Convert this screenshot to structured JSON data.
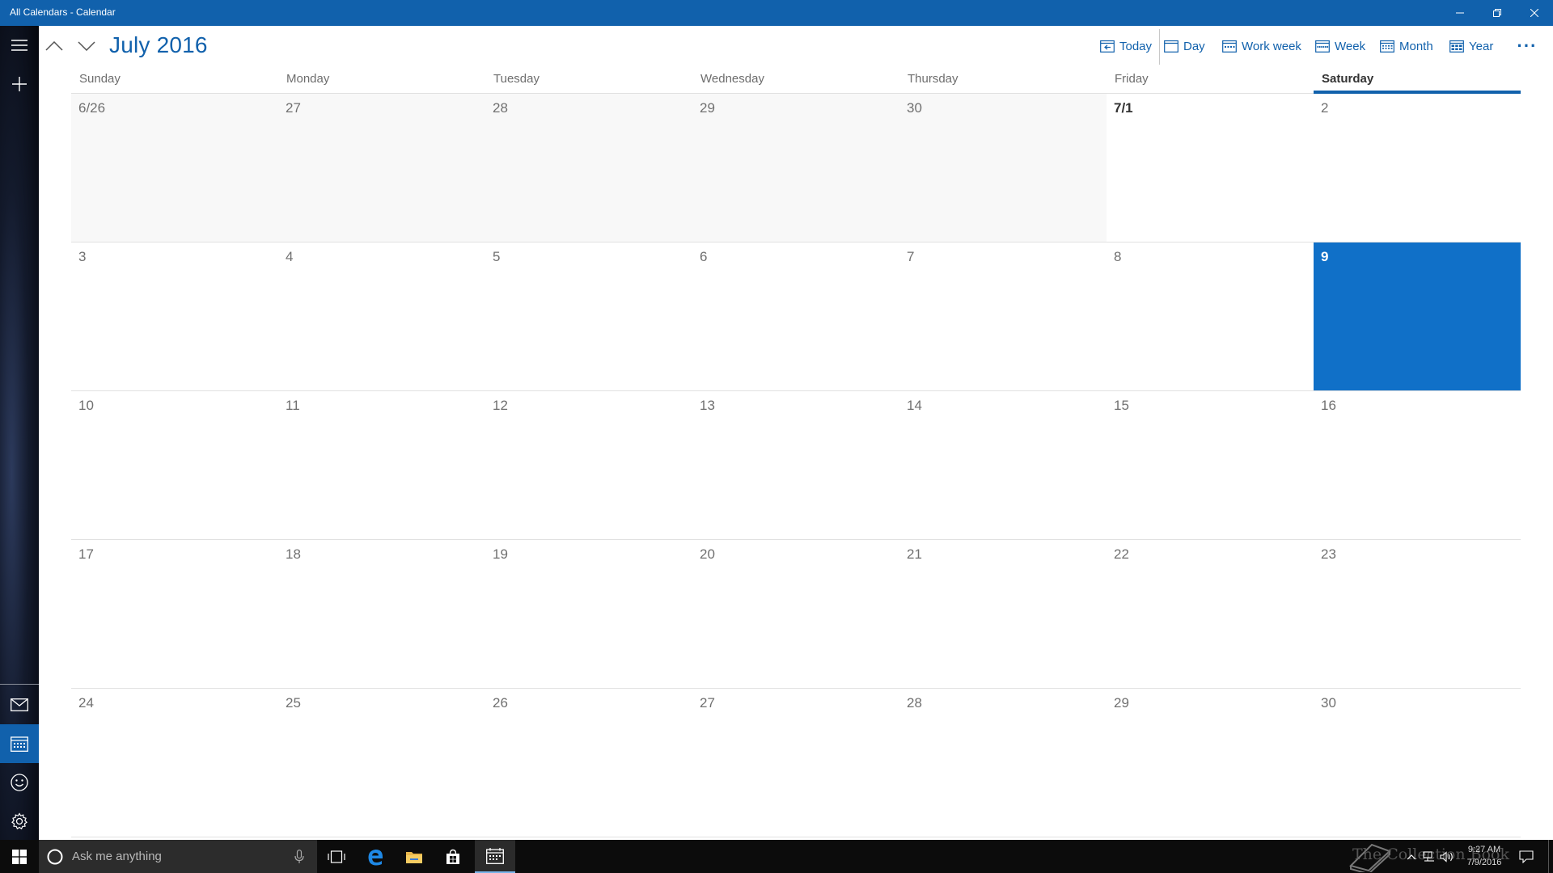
{
  "window": {
    "title": "All Calendars - Calendar"
  },
  "header": {
    "month_title": "July 2016",
    "views": [
      {
        "label": "Today",
        "icon": "today-icon"
      },
      {
        "label": "Day",
        "icon": "day-view-icon"
      },
      {
        "label": "Work week",
        "icon": "work-week-icon"
      },
      {
        "label": "Week",
        "icon": "week-view-icon"
      },
      {
        "label": "Month",
        "icon": "month-view-icon"
      },
      {
        "label": "Year",
        "icon": "year-view-icon"
      }
    ],
    "more": "···"
  },
  "weekdays": [
    "Sunday",
    "Monday",
    "Tuesday",
    "Wednesday",
    "Thursday",
    "Friday",
    "Saturday"
  ],
  "today_weekday_index": 6,
  "weeks": [
    [
      {
        "d": "6/26",
        "s": "outside"
      },
      {
        "d": "27",
        "s": "outside"
      },
      {
        "d": "28",
        "s": "outside"
      },
      {
        "d": "29",
        "s": "outside"
      },
      {
        "d": "30",
        "s": "outside"
      },
      {
        "d": "7/1",
        "s": "first"
      },
      {
        "d": "2",
        "s": ""
      }
    ],
    [
      {
        "d": "3",
        "s": ""
      },
      {
        "d": "4",
        "s": ""
      },
      {
        "d": "5",
        "s": ""
      },
      {
        "d": "6",
        "s": ""
      },
      {
        "d": "7",
        "s": ""
      },
      {
        "d": "8",
        "s": ""
      },
      {
        "d": "9",
        "s": "today"
      }
    ],
    [
      {
        "d": "10",
        "s": ""
      },
      {
        "d": "11",
        "s": ""
      },
      {
        "d": "12",
        "s": ""
      },
      {
        "d": "13",
        "s": ""
      },
      {
        "d": "14",
        "s": ""
      },
      {
        "d": "15",
        "s": ""
      },
      {
        "d": "16",
        "s": ""
      }
    ],
    [
      {
        "d": "17",
        "s": ""
      },
      {
        "d": "18",
        "s": ""
      },
      {
        "d": "19",
        "s": ""
      },
      {
        "d": "20",
        "s": ""
      },
      {
        "d": "21",
        "s": ""
      },
      {
        "d": "22",
        "s": ""
      },
      {
        "d": "23",
        "s": ""
      }
    ],
    [
      {
        "d": "24",
        "s": ""
      },
      {
        "d": "25",
        "s": ""
      },
      {
        "d": "26",
        "s": ""
      },
      {
        "d": "27",
        "s": ""
      },
      {
        "d": "28",
        "s": ""
      },
      {
        "d": "29",
        "s": ""
      },
      {
        "d": "30",
        "s": ""
      }
    ]
  ],
  "taskbar": {
    "search_placeholder": "Ask me anything",
    "clock_time": "9:27 AM",
    "clock_date": "7/9/2016",
    "watermark": "The Collection Book"
  },
  "colors": {
    "accent": "#1161ac",
    "today_fill": "#1070c8"
  }
}
